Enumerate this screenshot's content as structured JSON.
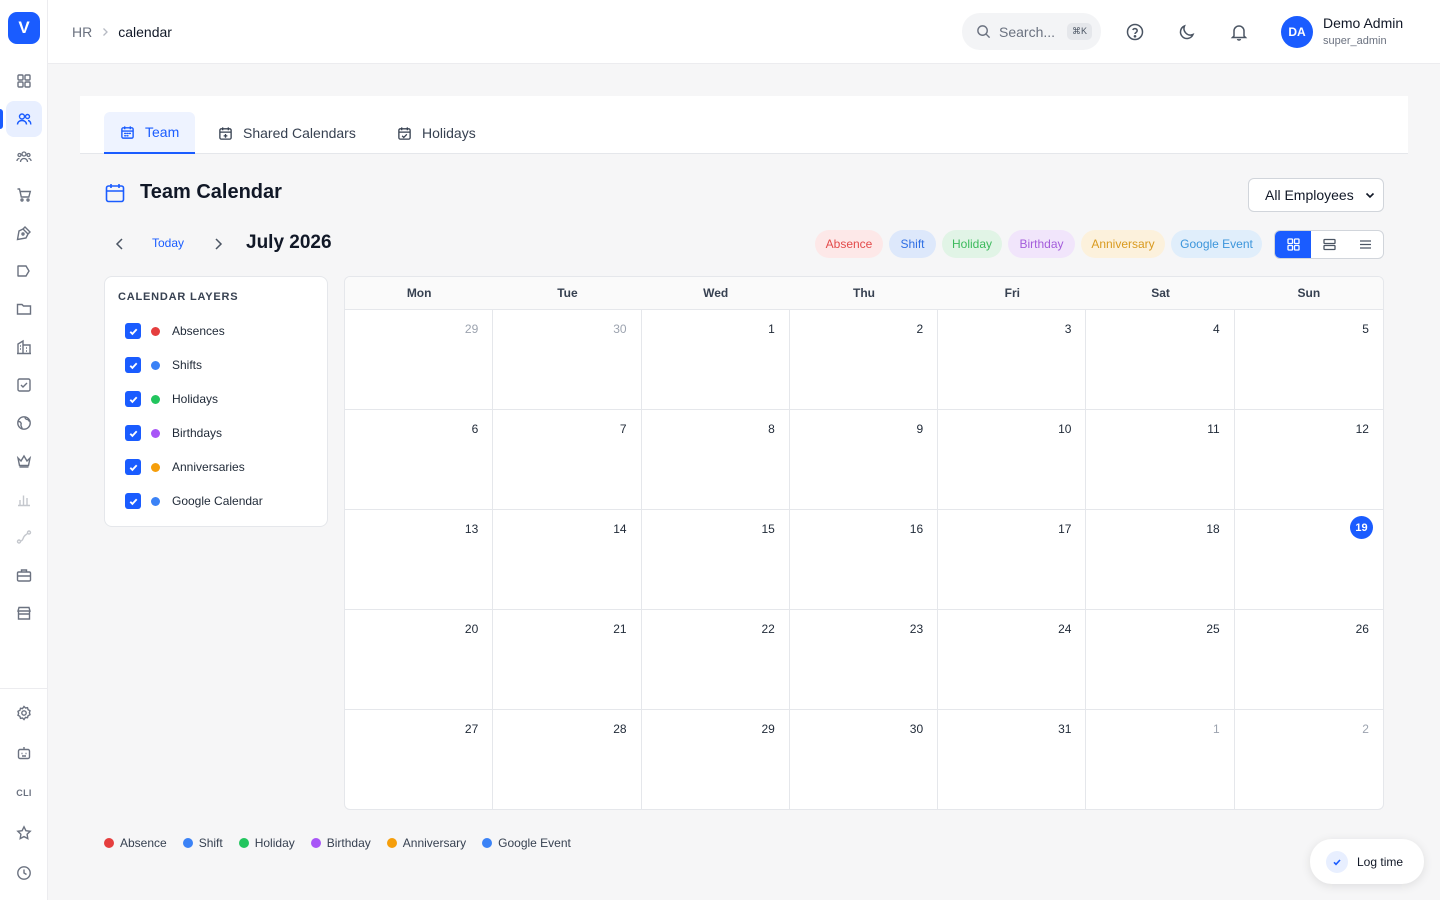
{
  "app": {
    "logo_letter": "V"
  },
  "breadcrumb": {
    "parent": "HR",
    "current": "calendar"
  },
  "search": {
    "placeholder": "Search...",
    "shortcut": "⌘K"
  },
  "user": {
    "initials": "DA",
    "name": "Demo Admin",
    "role": "super_admin"
  },
  "tabs": [
    {
      "label": "Team",
      "icon": "calendar-icon",
      "active": true
    },
    {
      "label": "Shared Calendars",
      "icon": "calendar-plus-icon",
      "active": false
    },
    {
      "label": "Holidays",
      "icon": "calendar-check-icon",
      "active": false
    }
  ],
  "page": {
    "title": "Team Calendar",
    "employee_filter": "All Employees"
  },
  "nav": {
    "today_label": "Today",
    "month_label": "July 2026"
  },
  "filters": [
    {
      "label": "Absence",
      "bg": "#fde8e8",
      "color": "#e34b4b"
    },
    {
      "label": "Shift",
      "bg": "#dde8fb",
      "color": "#2f6fe4"
    },
    {
      "label": "Holiday",
      "bg": "#e1f4e6",
      "color": "#3cba5c"
    },
    {
      "label": "Birthday",
      "bg": "#f1e5fb",
      "color": "#a45ddb"
    },
    {
      "label": "Anniversary",
      "bg": "#fcf1dc",
      "color": "#d99a1f"
    },
    {
      "label": "Google Event",
      "bg": "#e0eefb",
      "color": "#3b95db"
    }
  ],
  "view_modes": {
    "active": "month",
    "options": [
      "month",
      "week",
      "list"
    ]
  },
  "layers": {
    "heading": "CALENDAR LAYERS",
    "items": [
      {
        "label": "Absences",
        "color": "#e53e3e",
        "checked": true
      },
      {
        "label": "Shifts",
        "color": "#3b82f6",
        "checked": true
      },
      {
        "label": "Holidays",
        "color": "#22c55e",
        "checked": true
      },
      {
        "label": "Birthdays",
        "color": "#a855f7",
        "checked": true
      },
      {
        "label": "Anniversaries",
        "color": "#f59e0b",
        "checked": true
      },
      {
        "label": "Google Calendar",
        "color": "#3b82f6",
        "checked": true
      }
    ]
  },
  "calendar": {
    "weekdays": [
      "Mon",
      "Tue",
      "Wed",
      "Thu",
      "Fri",
      "Sat",
      "Sun"
    ],
    "weeks": [
      [
        "29",
        "30",
        "1",
        "2",
        "3",
        "4",
        "5"
      ],
      [
        "6",
        "7",
        "8",
        "9",
        "10",
        "11",
        "12"
      ],
      [
        "13",
        "14",
        "15",
        "16",
        "17",
        "18",
        "19"
      ],
      [
        "20",
        "21",
        "22",
        "23",
        "24",
        "25",
        "26"
      ],
      [
        "27",
        "28",
        "29",
        "30",
        "31",
        "1",
        "2"
      ]
    ],
    "outside_month": [
      [
        0,
        0
      ],
      [
        0,
        1
      ],
      [
        4,
        5
      ],
      [
        4,
        6
      ]
    ],
    "today": [
      2,
      6
    ]
  },
  "legend": [
    {
      "label": "Absence",
      "color": "#e53e3e"
    },
    {
      "label": "Shift",
      "color": "#3b82f6"
    },
    {
      "label": "Holiday",
      "color": "#22c55e"
    },
    {
      "label": "Birthday",
      "color": "#a855f7"
    },
    {
      "label": "Anniversary",
      "color": "#f59e0b"
    },
    {
      "label": "Google Event",
      "color": "#3b82f6"
    }
  ],
  "log_time": {
    "label": "Log time"
  },
  "sidebar_icons": [
    "dashboard-icon",
    "users-icon",
    "team-icon",
    "cart-icon",
    "pen-tool-icon",
    "megaphone-icon",
    "folder-icon",
    "building-icon",
    "checkbox-icon",
    "globe-icon",
    "crown-icon",
    "bar-chart-icon",
    "route-icon",
    "briefcase-icon",
    "store-icon",
    "settings-icon",
    "bot-icon",
    "cli-icon",
    "star-icon",
    "clock-icon"
  ],
  "sidebar_cli_text": "CLI"
}
